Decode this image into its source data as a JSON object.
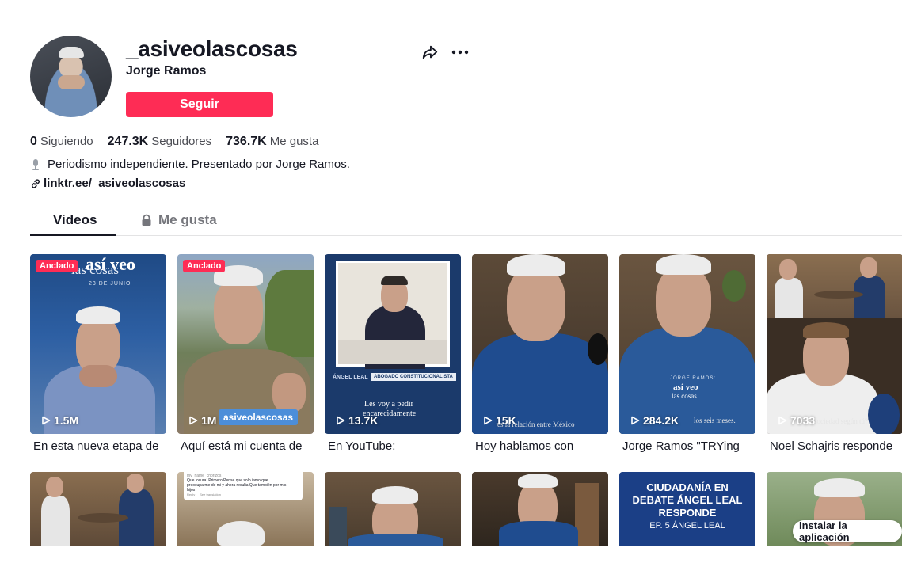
{
  "profile": {
    "username": "_asiveolascosas",
    "nickname": "Jorge Ramos",
    "follow_label": "Seguir",
    "stats": {
      "following_count": "0",
      "following_label": "Siguiendo",
      "followers_count": "247.3K",
      "followers_label": "Seguidores",
      "likes_count": "736.7K",
      "likes_label": "Me gusta"
    },
    "bio": "Periodismo independiente. Presentado por Jorge Ramos.",
    "link": "linktr.ee/_asiveolascosas"
  },
  "tabs": {
    "videos": "Videos",
    "likes": "Me gusta"
  },
  "videos": [
    {
      "caption": "En esta nueva etapa de",
      "views": "1.5M",
      "pinned": "Anclado",
      "overlay_title": "así veo",
      "overlay_title2": "las cosas",
      "overlay_date": "23 DE JUNIO"
    },
    {
      "caption": "Aquí está mi cuenta de",
      "views": "1M",
      "pinned": "Anclado",
      "overlay_tag": "asiveolascosas"
    },
    {
      "caption": "En YouTube:",
      "views": "13.7K",
      "overlay_name": "ÁNGEL LEAL",
      "overlay_role": "ABOGADO CONSTITUCIONALISTA",
      "overlay_text1": "Les voy a pedir",
      "overlay_text2": "encarecidamente"
    },
    {
      "caption": "Hoy hablamos con",
      "views": "15K",
      "overlay_text": "es la relación entre México"
    },
    {
      "caption": "Jorge Ramos \"TRYing",
      "views": "284.2K",
      "overlay_brand": "JORGE RAMOS:",
      "overlay_title": "así veo",
      "overlay_title2": "las cosas",
      "overlay_text": "los seis meses."
    },
    {
      "caption": "Noel Schajris responde",
      "views": "7033",
      "overlay_text": "sociedad según tú?"
    }
  ],
  "row2": [
    {},
    {
      "comment_user": "my_name_chorizos",
      "comment_text": "Que locura!  Primero Pense que solo iamo que preocuparme de mi y ahora resulta Que también por mis hijos",
      "comment_reply": "Reply",
      "comment_translate": "See translation"
    },
    {},
    {},
    {
      "title1": "CIUDADANÍA EN",
      "title2": "DEBATE ÁNGEL LEAL",
      "title3": "RESPONDE",
      "subtitle": "EP. 5 ÁNGEL LEAL"
    },
    {}
  ],
  "install_label": "Instalar la aplicación",
  "colors": {
    "accent": "#fe2c55",
    "text": "#161823",
    "muted": "#75767c"
  }
}
